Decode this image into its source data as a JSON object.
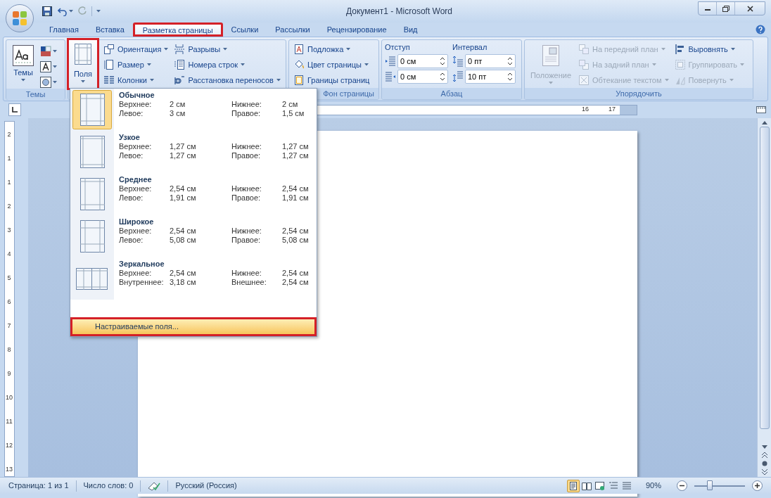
{
  "window": {
    "title": "Документ1 - Microsoft Word"
  },
  "tabs": [
    {
      "label": "Главная",
      "selected": false,
      "annotated": false
    },
    {
      "label": "Вставка",
      "selected": false,
      "annotated": false
    },
    {
      "label": "Разметка страницы",
      "selected": true,
      "annotated": true
    },
    {
      "label": "Ссылки",
      "selected": false,
      "annotated": false
    },
    {
      "label": "Рассылки",
      "selected": false,
      "annotated": false
    },
    {
      "label": "Рецензирование",
      "selected": false,
      "annotated": false
    },
    {
      "label": "Вид",
      "selected": false,
      "annotated": false
    }
  ],
  "ribbon": {
    "themes": {
      "label": "Темы",
      "button": "Темы",
      "small": [
        {
          "kind": "colors"
        },
        {
          "kind": "fonts"
        },
        {
          "kind": "effects"
        }
      ]
    },
    "page_setup": {
      "margins_button": {
        "label": "Поля",
        "annotated": true
      },
      "columns": [
        [
          {
            "label": "Ориентация",
            "kind": "orientation",
            "disabled": false
          },
          {
            "label": "Размер",
            "kind": "size",
            "disabled": false
          },
          {
            "label": "Колонки",
            "kind": "columns",
            "disabled": false
          }
        ],
        [
          {
            "label": "Разрывы",
            "kind": "breaks",
            "disabled": false
          },
          {
            "label": "Номера строк",
            "kind": "numbering",
            "disabled": false
          },
          {
            "label": "Расстановка переносов",
            "kind": "hyphenation",
            "disabled": false
          }
        ]
      ]
    },
    "page_background": {
      "label": "Фон страницы",
      "items": [
        {
          "label": "Подложка",
          "kind": "watermark",
          "caret": true,
          "disabled": false
        },
        {
          "label": "Цвет страницы",
          "kind": "color",
          "caret": true,
          "disabled": false
        },
        {
          "label": "Границы страниц",
          "kind": "borders",
          "caret": false,
          "disabled": false
        }
      ]
    },
    "paragraph": {
      "label": "Абзац",
      "indent": {
        "label": "Отступ",
        "fields": [
          {
            "value": "0 см",
            "kind": "left"
          },
          {
            "value": "0 см",
            "kind": "right"
          }
        ]
      },
      "spacing": {
        "label": "Интервал",
        "fields": [
          {
            "value": "0 пт",
            "kind": "before"
          },
          {
            "value": "10 пт",
            "kind": "after"
          }
        ]
      }
    },
    "arrange": {
      "label": "Упорядочить",
      "position": {
        "label": "Положение",
        "disabled": true
      },
      "columns": [
        [
          {
            "label": "На передний план",
            "kind": "front",
            "disabled": true
          },
          {
            "label": "На задний план",
            "kind": "back",
            "disabled": true
          },
          {
            "label": "Обтекание текстом",
            "kind": "wrap",
            "disabled": true
          }
        ],
        [
          {
            "label": "Выровнять",
            "kind": "align",
            "disabled": false
          },
          {
            "label": "Группировать",
            "kind": "group",
            "disabled": true
          },
          {
            "label": "Повернуть",
            "kind": "rotate",
            "disabled": true
          }
        ]
      ]
    }
  },
  "margins_menu": {
    "items": [
      {
        "name": "Обычное",
        "kind": "normal",
        "selected": true,
        "rows": [
          {
            "label_1": "Верхнее:",
            "value_1": "2 см",
            "label_2": "Нижнее:",
            "value_2": "2 см"
          },
          {
            "label_1": "Левое:",
            "value_1": "3 см",
            "label_2": "Правое:",
            "value_2": "1,5 см"
          }
        ]
      },
      {
        "name": "Узкое",
        "kind": "narrow",
        "selected": false,
        "rows": [
          {
            "label_1": "Верхнее:",
            "value_1": "1,27 см",
            "label_2": "Нижнее:",
            "value_2": "1,27 см"
          },
          {
            "label_1": "Левое:",
            "value_1": "1,27 см",
            "label_2": "Правое:",
            "value_2": "1,27 см"
          }
        ]
      },
      {
        "name": "Среднее",
        "kind": "moderate",
        "selected": false,
        "rows": [
          {
            "label_1": "Верхнее:",
            "value_1": "2,54 см",
            "label_2": "Нижнее:",
            "value_2": "2,54 см"
          },
          {
            "label_1": "Левое:",
            "value_1": "1,91 см",
            "label_2": "Правое:",
            "value_2": "1,91 см"
          }
        ]
      },
      {
        "name": "Широкое",
        "kind": "wide",
        "selected": false,
        "rows": [
          {
            "label_1": "Верхнее:",
            "value_1": "2,54 см",
            "label_2": "Нижнее:",
            "value_2": "2,54 см"
          },
          {
            "label_1": "Левое:",
            "value_1": "5,08 см",
            "label_2": "Правое:",
            "value_2": "5,08 см"
          }
        ]
      },
      {
        "name": "Зеркальное",
        "kind": "mirrored",
        "selected": false,
        "rows": [
          {
            "label_1": "Верхнее:",
            "value_1": "2,54 см",
            "label_2": "Нижнее:",
            "value_2": "2,54 см"
          },
          {
            "label_1": "Внутреннее:",
            "value_1": "3,18 см",
            "label_2": "Внешнее:",
            "value_2": "2,54 см"
          }
        ]
      }
    ],
    "footer": {
      "label": "Настраиваемые поля...",
      "annotated": true
    }
  },
  "ruler": {
    "horizontal_labels": [
      "16",
      "17"
    ],
    "vertical_labels": [
      "2",
      "1",
      "1",
      "2",
      "3",
      "4",
      "5",
      "6",
      "7",
      "8",
      "9",
      "10",
      "11",
      "12",
      "13"
    ]
  },
  "status_bar": {
    "page": "Страница: 1 из 1",
    "words": "Число слов: 0",
    "language": "Русский (Россия)",
    "views": [
      {
        "kind": "print",
        "selected": true
      },
      {
        "kind": "reading",
        "selected": false
      },
      {
        "kind": "web",
        "selected": false
      },
      {
        "kind": "outline",
        "selected": false
      },
      {
        "kind": "draft",
        "selected": false
      }
    ],
    "zoom": "90%",
    "zoom_slider": {
      "level": 0.3
    }
  }
}
